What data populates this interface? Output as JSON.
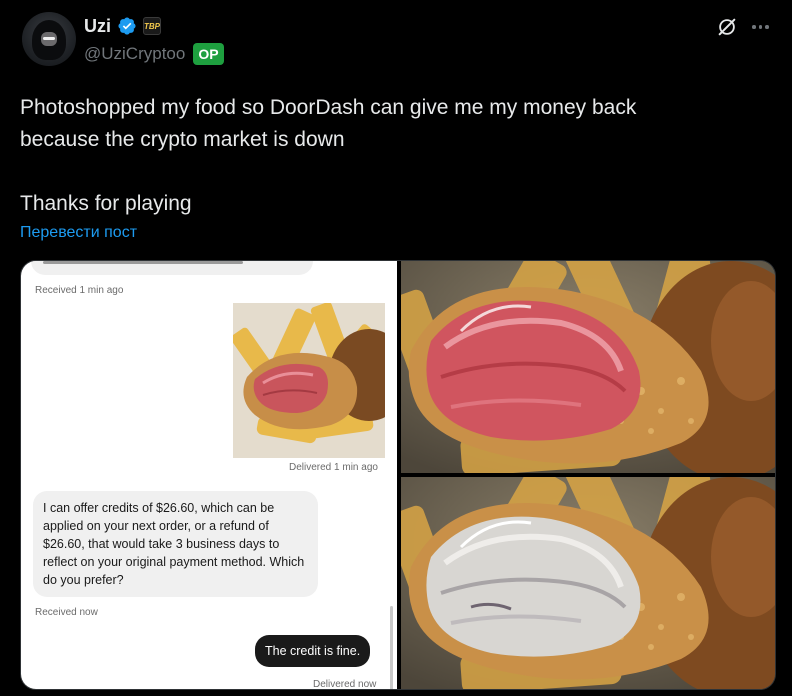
{
  "author": {
    "display_name": "Uzi",
    "handle": "@UziCryptoo",
    "op_badge": "OP",
    "affiliate_badge": "TBP"
  },
  "icons": {
    "verified": "verified-badge-icon",
    "grok": "grok-icon",
    "more": "more-icon"
  },
  "tweet": {
    "line1": "Photoshopped my food so DoorDash can give me my money back",
    "line2": "because the crypto market is down",
    "line3": "Thanks for playing",
    "translate_label": "Перевести пост"
  },
  "screenshot_chat": {
    "received_1": "Received 1 min ago",
    "delivered_1": "Delivered 1 min ago",
    "agent_message": "I can offer credits of $26.60, which can be applied on your next order, or a refund of $26.60, that would take 3 business days to reflect on your original payment method. Which do you prefer?",
    "received_2": "Received now",
    "user_message": "The credit is fine.",
    "delivered_2": "Delivered now"
  },
  "colors": {
    "background": "#000000",
    "text": "#e7e9ea",
    "secondary": "#71767b",
    "link": "#1d9bf0",
    "verified": "#1d9bf0",
    "op_badge": "#1e9f3f"
  }
}
